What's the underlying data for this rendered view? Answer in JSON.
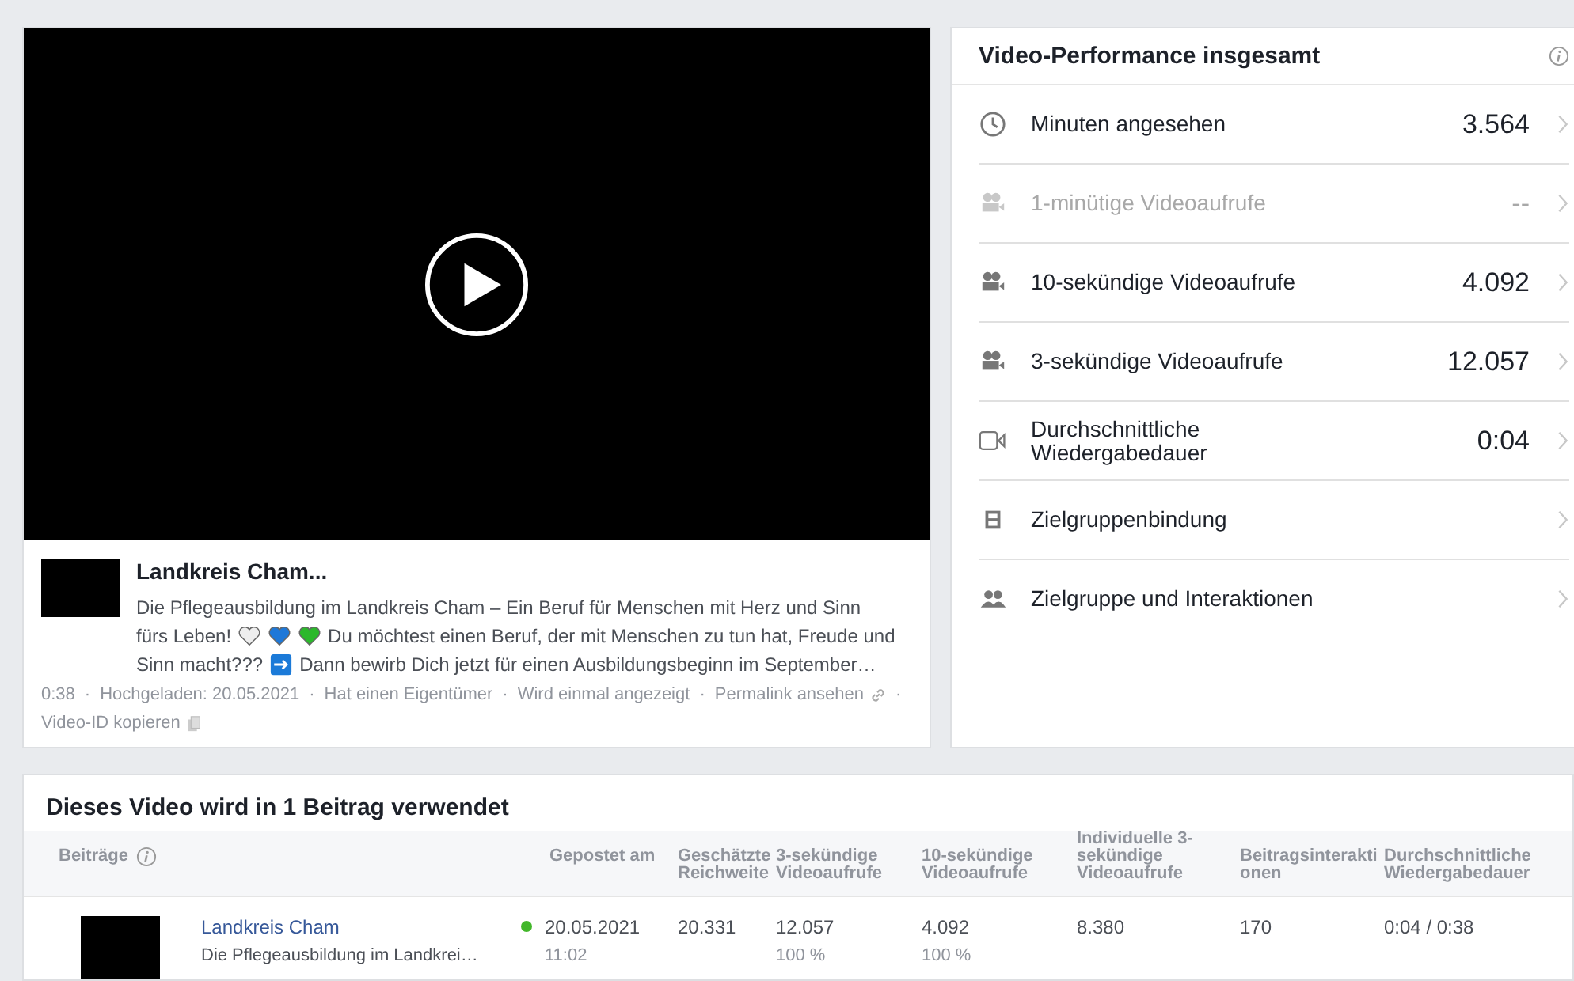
{
  "video": {
    "post": {
      "title": "Landkreis Cham...",
      "description_lines": [
        [
          {
            "kind": "text",
            "text": "Die Pflegeausbildung im Landkreis Cham – Ein Beruf für Menschen mit Herz und Sinn"
          }
        ],
        [
          {
            "kind": "text",
            "text": "fürs Leben!"
          },
          {
            "kind": "heart",
            "color": "#eeeeee"
          },
          {
            "kind": "heart",
            "color": "#1e78d8"
          },
          {
            "kind": "heart",
            "color": "#2cb82c"
          },
          {
            "kind": "text",
            "text": "Du möchtest einen Beruf, der mit Menschen zu tun hat, Freude und"
          }
        ],
        [
          {
            "kind": "text",
            "text": "Sinn macht???"
          },
          {
            "kind": "arrow"
          },
          {
            "kind": "text",
            "text": "Dann bewirb Dich jetzt für einen Ausbildungsbeginn im September…"
          }
        ]
      ]
    },
    "separator": "·",
    "meta": [
      {
        "kind": "text",
        "text": "0:38"
      },
      {
        "kind": "text",
        "text": "Hochgeladen: 20.05.2021"
      },
      {
        "kind": "text",
        "text": "Hat einen Eigentümer"
      },
      {
        "kind": "text",
        "text": "Wird einmal angezeigt"
      },
      {
        "kind": "link",
        "text": "Permalink ansehen"
      },
      {
        "kind": "copy",
        "text": "Video-ID kopieren"
      }
    ]
  },
  "performance": {
    "title": "Video-Performance insgesamt",
    "metrics": [
      {
        "kind": "clock",
        "label": "Minuten angesehen",
        "value": "3.564",
        "disabled": false
      },
      {
        "kind": "camera",
        "label": "1-minütige Videoaufrufe",
        "value": "--",
        "disabled": true
      },
      {
        "kind": "camera",
        "label": "10-sekündige Videoaufrufe",
        "value": "4.092",
        "disabled": false
      },
      {
        "kind": "camera",
        "label": "3-sekündige Videoaufrufe",
        "value": "12.057",
        "disabled": false
      },
      {
        "kind": "video",
        "label": "Durchschnittliche Wiedergabedauer",
        "value": "0:04",
        "disabled": false
      },
      {
        "kind": "film",
        "label": "Zielgruppenbindung",
        "disabled": false
      },
      {
        "kind": "people",
        "label": "Zielgruppe und Interaktionen",
        "disabled": false
      }
    ]
  },
  "posts_table": {
    "title": "Dieses Video wird in 1 Beitrag verwendet",
    "columns": [
      "Beiträge",
      "Gepostet am",
      "Geschätzte Reichweite",
      "3-sekündige Videoaufrufe",
      "10-sekündige Videoaufrufe",
      "Individuelle 3-sekündige Videoaufrufe",
      "Beitragsinteraktionen",
      "Durchschnittliche Wiedergabedauer"
    ],
    "rows": [
      {
        "title": "Landkreis Cham",
        "excerpt": "Die Pflegeausbildung im Landkrei…",
        "color": "#42b72a",
        "date": "20.05.2021",
        "time": "11:02",
        "reach": "20.331",
        "views_3s": "12.057",
        "views_3s_pct": "100 %",
        "views_10s": "4.092",
        "views_10s_pct": "100 %",
        "unique_3s": "8.380",
        "interactions": "170",
        "avg_duration": "0:04 / 0:38"
      }
    ]
  }
}
